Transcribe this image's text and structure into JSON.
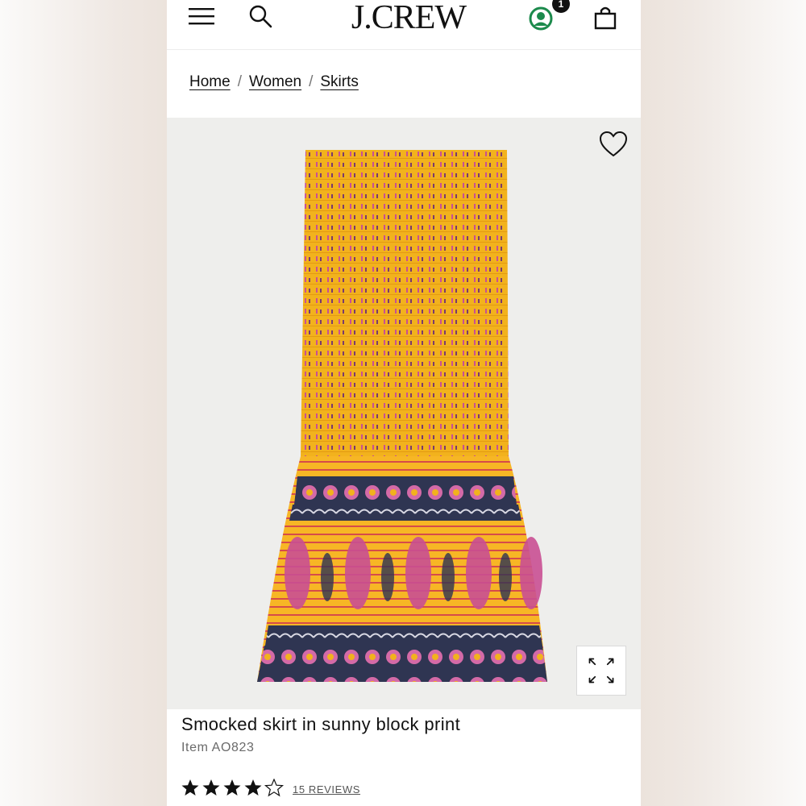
{
  "header": {
    "logo": "J.CREW",
    "account_badge": "1"
  },
  "breadcrumb": {
    "items": [
      "Home",
      "Women",
      "Skirts"
    ],
    "separator": "/"
  },
  "product": {
    "title": "Smocked skirt in sunny block print",
    "item_code": "Item AO823",
    "rating": 4.5,
    "reviews_label": "15 REVIEWS"
  },
  "icons": {
    "menu": "hamburger-icon",
    "search": "search-icon",
    "account": "account-icon",
    "bag": "shopping-bag-icon",
    "wishlist": "heart-icon",
    "expand": "expand-icon"
  },
  "colors": {
    "account_green": "#1c8a4c",
    "skirt_yellow": "#f2b21d",
    "skirt_pink": "#c94f93",
    "skirt_navy": "#2f3552"
  }
}
